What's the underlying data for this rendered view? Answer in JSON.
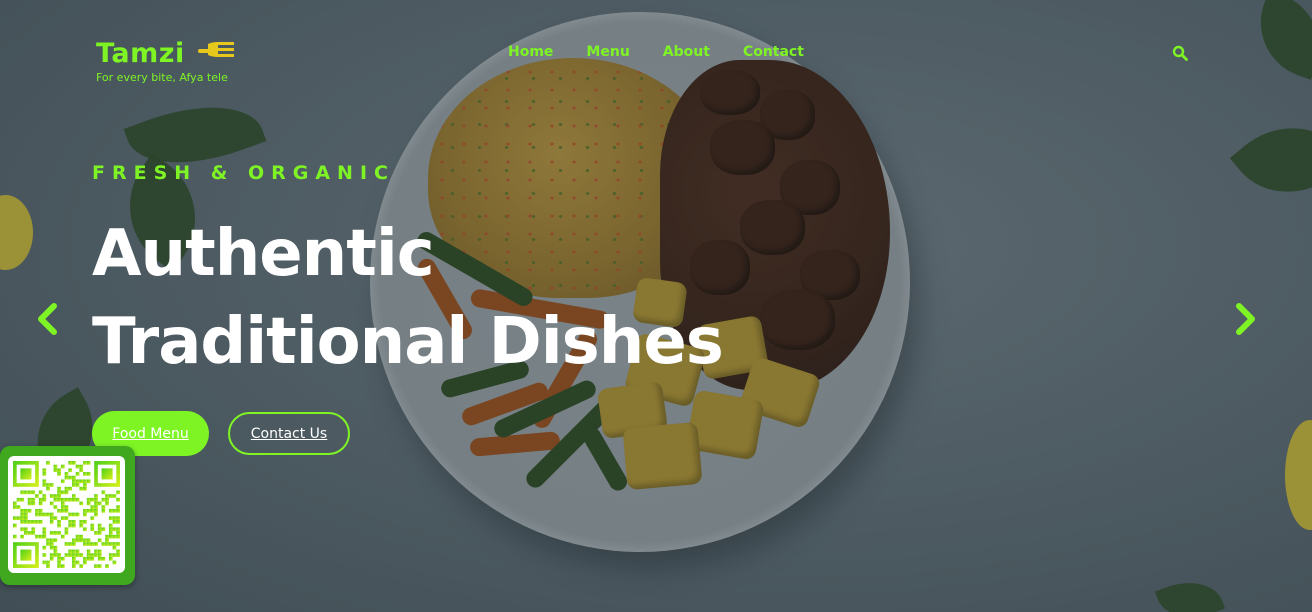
{
  "brand": {
    "logo_text": "Tamzi",
    "tagline": "For every bite, Afya tele",
    "accent_color": "#7ef425"
  },
  "nav": {
    "items": [
      {
        "label": "Home"
      },
      {
        "label": "Menu"
      },
      {
        "label": "About"
      },
      {
        "label": "Contact"
      }
    ],
    "search_icon": "search-icon"
  },
  "hero": {
    "eyebrow": "FRESH & ORGANIC",
    "headline_line1": "Authentic",
    "headline_line2": "Traditional Dishes",
    "primary_button": "Food Menu",
    "secondary_button": "Contact Us",
    "prev_icon": "chevron-left-icon",
    "next_icon": "chevron-right-icon"
  },
  "qr": {
    "icon": "qr-code-icon"
  }
}
